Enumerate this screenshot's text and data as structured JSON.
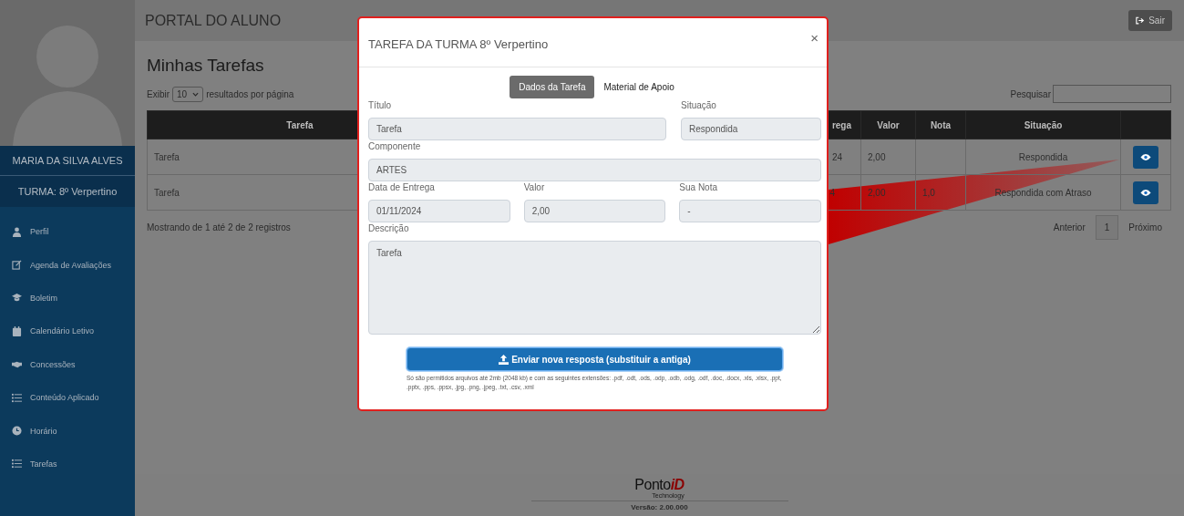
{
  "header": {
    "title": "PORTAL DO ALUNO",
    "logout_button": "Sair"
  },
  "sidebar": {
    "student_name": "MARIA DA SILVA ALVES",
    "class_label": "TURMA: 8º Verpertino",
    "items": [
      {
        "label": "Perfil",
        "kind": "user"
      },
      {
        "label": "Agenda de Avaliações",
        "kind": "edit"
      },
      {
        "label": "Boletim",
        "kind": "cap"
      },
      {
        "label": "Calendário Letivo",
        "kind": "calendar"
      },
      {
        "label": "Concessões",
        "kind": "handshake"
      },
      {
        "label": "Conteúdo Aplicado",
        "kind": "list"
      },
      {
        "label": "Horário",
        "kind": "clock"
      },
      {
        "label": "Tarefas",
        "kind": "list"
      }
    ]
  },
  "page": {
    "heading": "Minhas Tarefas",
    "page_size_prefix": "Exibir",
    "page_size": "10",
    "page_size_suffix": "resultados por página",
    "search_label": "Pesquisar"
  },
  "table": {
    "columns": [
      "Tarefa",
      "rega",
      "Valor",
      "Nota",
      "Situação"
    ],
    "rows": [
      {
        "task": "Tarefa",
        "due_date": "24",
        "value": "2,00",
        "status": "Respondida"
      },
      {
        "task": "Tarefa",
        "due_date": "4",
        "value": "2,00",
        "grade": "1,0",
        "status": "Respondida com Atraso"
      }
    ]
  },
  "info": "Mostrando de 1 até 2 de 2 registros",
  "pagination": {
    "previous": "Anterior",
    "current_page": "1",
    "next": "Próximo"
  },
  "footer": {
    "brand": "Ponto",
    "brand_accent": "iD",
    "brand_tagline": "Technology",
    "version": "Versão: 2.00.000"
  },
  "modal": {
    "title": "TAREFA DA TURMA 8º Verpertino",
    "close": "×",
    "tabs": [
      {
        "label": "Dados da Tarefa",
        "selected": true
      },
      {
        "label": "Material de Apoio",
        "selected": false
      }
    ],
    "field_rows": [
      {
        "kind": "two",
        "fields": [
          {
            "label": "Título",
            "value": "Tarefa"
          },
          {
            "label": "Situação",
            "value": "Respondida"
          }
        ]
      },
      {
        "kind": "one",
        "fields": [
          {
            "label": "Componente",
            "value": "ARTES"
          }
        ]
      },
      {
        "kind": "three",
        "fields": [
          {
            "label": "Data de Entrega",
            "value": "01/11/2024"
          },
          {
            "label": "Valor",
            "value": "2,00"
          },
          {
            "label": "Sua Nota",
            "value": "-"
          }
        ]
      }
    ],
    "description": {
      "label": "Descrição",
      "value": "Tarefa"
    },
    "upload_button": "Enviar nova resposta (substituir a antiga)",
    "upload_note": "Só são permitidos arquivos até 2mb (2048 kb) e com as seguintes extensões: .pdf, .odt, .ods, .odp, .odb, .odg, .odf, .doc, .docx, .xls, .xlsx, .ppt, .pptx, .pps, .ppsx, .jpg, .png, .jpeg, .txt, .csv, .xml"
  }
}
